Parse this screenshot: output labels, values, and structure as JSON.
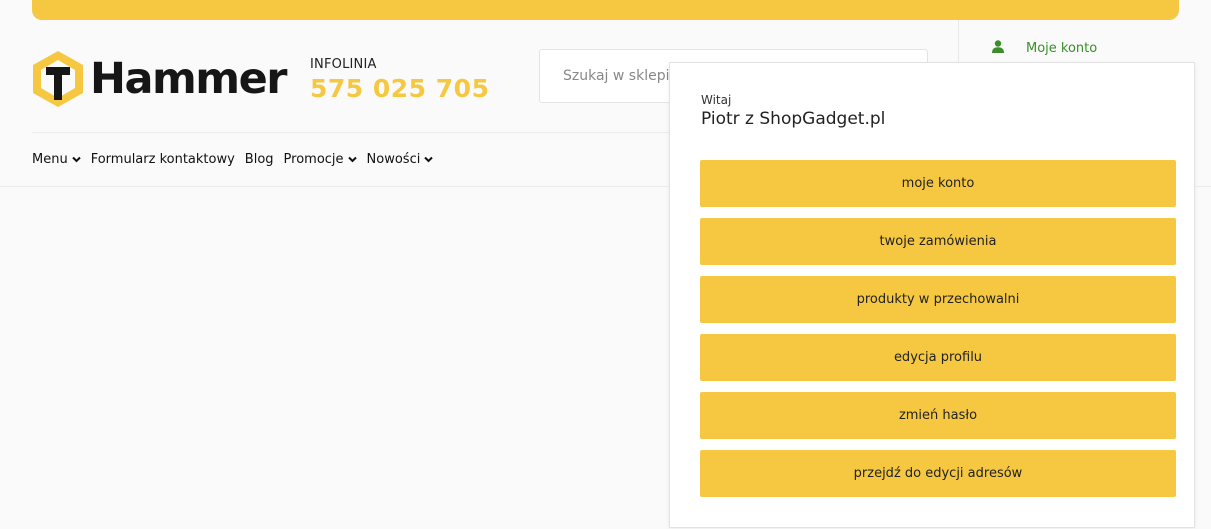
{
  "header": {
    "logo_text": "Hammer",
    "hotline_label": "INFOLINIA",
    "hotline_number": "575 025 705",
    "search_placeholder": "Szukaj w sklepie",
    "account_link": "Moje konto"
  },
  "nav": {
    "items": [
      {
        "label": "Menu",
        "icon": "chevron-down-icon"
      },
      {
        "label": "Formularz kontaktowy"
      },
      {
        "label": "Blog"
      },
      {
        "label": "Promocje",
        "icon": "chevron-down-icon"
      },
      {
        "label": "Nowości",
        "icon": "chevron-down-icon"
      }
    ]
  },
  "account_menu": {
    "greeting": "Witaj",
    "user_name": "Piotr z ShopGadget.pl",
    "items": [
      {
        "label": "moje konto"
      },
      {
        "label": "twoje zamówienia"
      },
      {
        "label": "produkty w przechowalni"
      },
      {
        "label": "edycja profilu"
      },
      {
        "label": "zmień hasło"
      },
      {
        "label": "przejdź do edycji adresów"
      }
    ]
  },
  "colors": {
    "accent": "#f6c842",
    "account_link": "#3b8f2a",
    "dark": "#161616"
  }
}
